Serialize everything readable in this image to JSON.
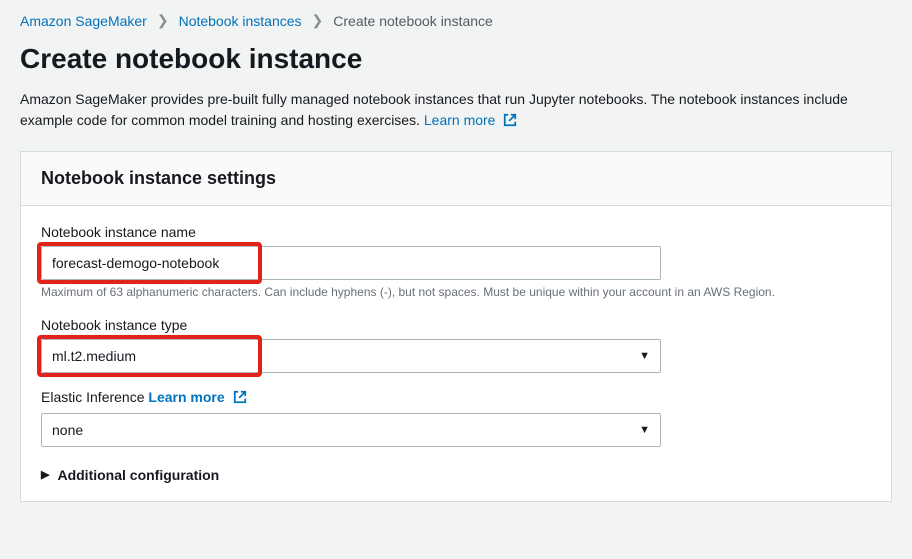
{
  "breadcrumb": {
    "root": "Amazon SageMaker",
    "mid": "Notebook instances",
    "current": "Create notebook instance"
  },
  "page": {
    "title": "Create notebook instance",
    "intro": "Amazon SageMaker provides pre-built fully managed notebook instances that run Jupyter notebooks. The notebook instances include example code for common model training and hosting exercises.",
    "learn_more": "Learn more"
  },
  "panel": {
    "title": "Notebook instance settings",
    "name_label": "Notebook instance name",
    "name_value": "forecast-demogo-notebook",
    "name_hint": "Maximum of 63 alphanumeric characters. Can include hyphens (-), but not spaces. Must be unique within your account in an AWS Region.",
    "type_label": "Notebook instance type",
    "type_value": "ml.t2.medium",
    "elastic_label": "Elastic Inference",
    "elastic_learn_more": "Learn more",
    "elastic_value": "none",
    "additional": "Additional configuration"
  }
}
